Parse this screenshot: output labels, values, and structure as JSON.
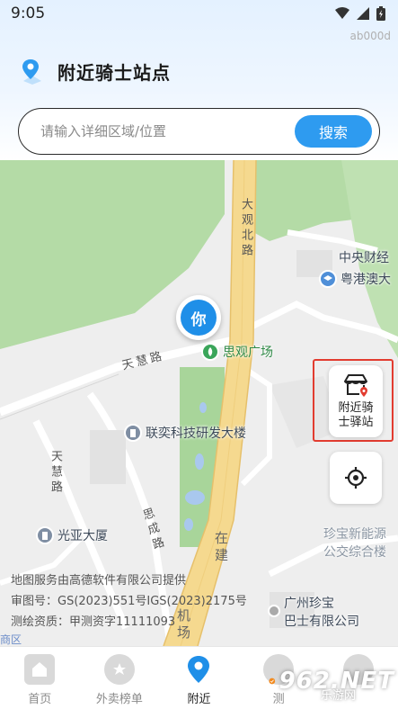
{
  "status_bar": {
    "time": "9:05",
    "device_code": "ab000d"
  },
  "header": {
    "title": "附近骑士站点"
  },
  "search": {
    "placeholder": "请输入详细区域/位置",
    "button_label": "搜索"
  },
  "map": {
    "road_labels": {
      "daguan_north_road": "大观北路",
      "tianhui_road_h": "天慧路",
      "tianhui_road_v": "天慧路",
      "sicheng_road": "思成路",
      "zaijian": "在建",
      "ji_chang": "机场"
    },
    "pois": {
      "sigu_square": "思观广场",
      "lianyi_building": "联奕科技研发大楼",
      "guangya_building": "光亚大厦",
      "zhongyang_caijing": "中央财经",
      "yuegang_ao": "粤港澳大",
      "zhenbao_new_energy": "珍宝新能源",
      "bus_station": "公交综合楼",
      "guangzhou_zhenbao": "广州珍宝",
      "bus_company": "巴士有限公司",
      "corner_label": "商区"
    },
    "you_marker": "你",
    "station_button": "附近骑士驿站",
    "attribution": {
      "line1": "地图服务由高德软件有限公司提供",
      "line2": "审图号：GS(2023)551号IGS(2023)2175号",
      "line3": "测绘资质：甲测资字11111093"
    },
    "colors": {
      "green": "#b4dba6",
      "road": "#ffffff",
      "highway": "#f5d98f",
      "water": "#a9c8ee"
    }
  },
  "bottom_nav": {
    "items": [
      {
        "label": "首页",
        "icon": "home-icon",
        "active": false
      },
      {
        "label": "外卖榜单",
        "icon": "medal-icon",
        "active": false
      },
      {
        "label": "附近",
        "icon": "location-pin-icon",
        "active": true
      },
      {
        "label": "测",
        "icon": "test-icon",
        "active": false
      },
      {
        "label": "",
        "icon": "profile-icon",
        "active": false
      }
    ]
  },
  "watermark": {
    "brand": "962.NET",
    "sub": "乐游网"
  },
  "colors": {
    "accent": "#2e9bf0",
    "highlight": "#e23c30"
  }
}
